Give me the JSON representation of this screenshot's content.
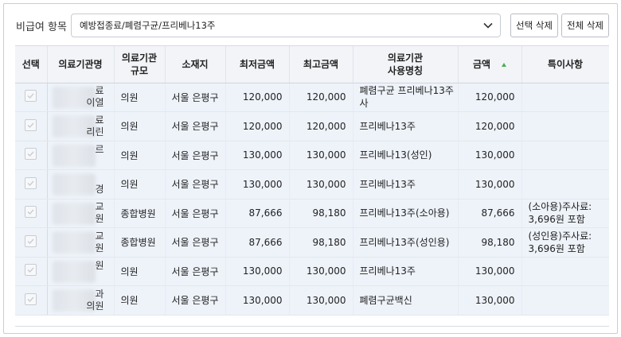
{
  "filter": {
    "label": "비급여 항목",
    "selected": "예방접종료/폐렴구균/프리베나13주",
    "btn_select_delete": "선택 삭제",
    "btn_all_delete": "전체 삭제"
  },
  "table": {
    "headers": {
      "select": "선택",
      "name": "의료기관명",
      "scale_1": "의료기관",
      "scale_2": "규모",
      "location": "소재지",
      "min": "최저금액",
      "max": "최고금액",
      "usename_1": "의료기관",
      "usename_2": "사용명칭",
      "amount": "금액",
      "note": "특이사항"
    },
    "rows": [
      {
        "name_frag_1": "료",
        "name_frag_2": "이열",
        "scale": "의원",
        "location": "서울 은평구",
        "min": "120,000",
        "max": "120,000",
        "usename": "폐렴구균 프리베나13주사",
        "amount": "120,000",
        "note": ""
      },
      {
        "name_frag_1": "료",
        "name_frag_2": "리린",
        "scale": "의원",
        "location": "서울 은평구",
        "min": "120,000",
        "max": "120,000",
        "usename": "프리베나13주",
        "amount": "120,000",
        "note": ""
      },
      {
        "name_frag_1": "르",
        "name_frag_2": "",
        "scale": "의원",
        "location": "서울 은평구",
        "min": "130,000",
        "max": "130,000",
        "usename": "프리베나13(성인)",
        "amount": "130,000",
        "note": ""
      },
      {
        "name_frag_1": "",
        "name_frag_2": "경",
        "scale": "의원",
        "location": "서울 은평구",
        "min": "130,000",
        "max": "130,000",
        "usename": "프리베나13주",
        "amount": "130,000",
        "note": ""
      },
      {
        "name_frag_1": "교",
        "name_frag_2": "원",
        "scale": "종합병원",
        "location": "서울 은평구",
        "min": "87,666",
        "max": "98,180",
        "usename": "프리베나13주(소아용)",
        "amount": "87,666",
        "note": "(소아용)주사료: 3,696원 포함"
      },
      {
        "name_frag_1": "교",
        "name_frag_2": "원",
        "scale": "종합병원",
        "location": "서울 은평구",
        "min": "87,666",
        "max": "98,180",
        "usename": "프리베나13주(성인용)",
        "amount": "98,180",
        "note": "(성인용)주사료: 3,696원 포함"
      },
      {
        "name_frag_1": "원",
        "name_frag_2": "",
        "scale": "의원",
        "location": "서울 은평구",
        "min": "130,000",
        "max": "130,000",
        "usename": "프리베나13주",
        "amount": "130,000",
        "note": ""
      },
      {
        "name_frag_1": "과",
        "name_frag_2": "의원",
        "scale": "의원",
        "location": "서울 은평구",
        "min": "130,000",
        "max": "130,000",
        "usename": "폐렴구균백신",
        "amount": "130,000",
        "note": ""
      }
    ]
  }
}
